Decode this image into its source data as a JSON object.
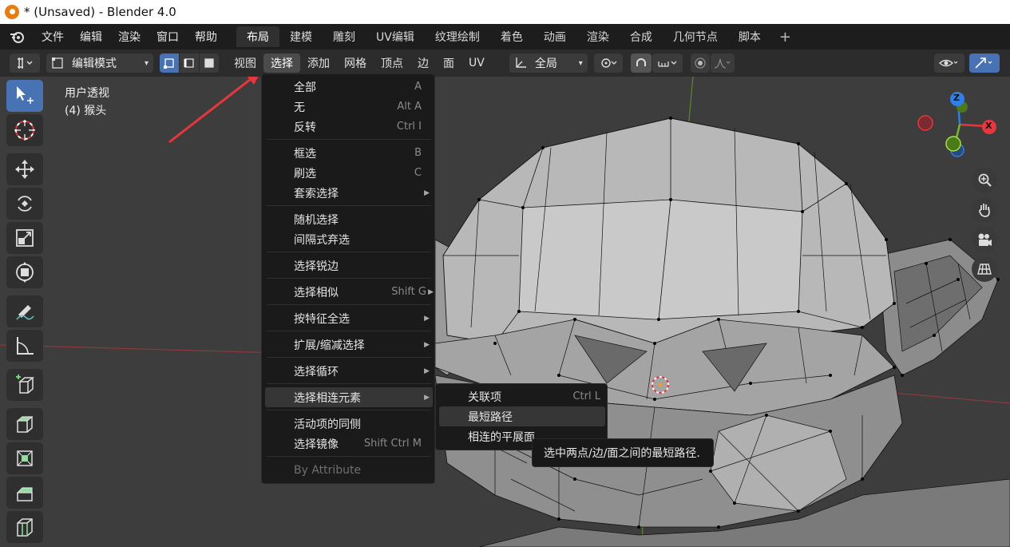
{
  "window": {
    "title": "* (Unsaved) - Blender 4.0"
  },
  "menubar": {
    "items": [
      "文件",
      "编辑",
      "渲染",
      "窗口",
      "帮助"
    ],
    "workspaces": [
      "布局",
      "建模",
      "雕刻",
      "UV编辑",
      "纹理绘制",
      "着色",
      "动画",
      "渲染",
      "合成",
      "几何节点",
      "脚本"
    ],
    "active_workspace": "布局",
    "add_symbol": "+"
  },
  "header": {
    "mode": "编辑模式",
    "menus": [
      "视图",
      "选择",
      "添加",
      "网格",
      "顶点",
      "边",
      "面",
      "UV"
    ],
    "active_menu": "选择",
    "orientation": "全局"
  },
  "viewport": {
    "view_name": "用户透视",
    "object_name": "(4) 猴头",
    "gizmo": {
      "x": "X",
      "z": "Z"
    }
  },
  "select_menu": {
    "items": [
      {
        "label": "全部",
        "shortcut": "A"
      },
      {
        "label": "无",
        "shortcut": "Alt A"
      },
      {
        "label": "反转",
        "shortcut": "Ctrl I"
      },
      {
        "label": "框选",
        "shortcut": "B"
      },
      {
        "label": "刷选",
        "shortcut": "C"
      },
      {
        "label": "套索选择",
        "shortcut": ""
      },
      {
        "label": "随机选择",
        "shortcut": ""
      },
      {
        "label": "间隔式弃选",
        "shortcut": ""
      },
      {
        "label": "选择锐边",
        "shortcut": ""
      },
      {
        "label": "选择相似",
        "shortcut": "Shift G"
      },
      {
        "label": "按特征全选",
        "shortcut": ""
      },
      {
        "label": "扩展/缩减选择",
        "shortcut": ""
      },
      {
        "label": "选择循环",
        "shortcut": ""
      },
      {
        "label": "选择相连元素",
        "shortcut": ""
      },
      {
        "label": "活动项的同侧",
        "shortcut": ""
      },
      {
        "label": "选择镜像",
        "shortcut": "Shift Ctrl M"
      },
      {
        "label": "By Attribute",
        "shortcut": ""
      }
    ]
  },
  "linked_submenu": {
    "items": [
      {
        "label": "关联项",
        "shortcut": "Ctrl L"
      },
      {
        "label": "最短路径",
        "shortcut": ""
      },
      {
        "label": "相连的平展面",
        "shortcut": ""
      }
    ]
  },
  "tooltip": {
    "text": "选中两点/边/面之间的最短路径."
  },
  "colors": {
    "accent": "#4772b3",
    "annotation_arrow": "#e8363c",
    "menu_bg": "#1a1a1a"
  }
}
